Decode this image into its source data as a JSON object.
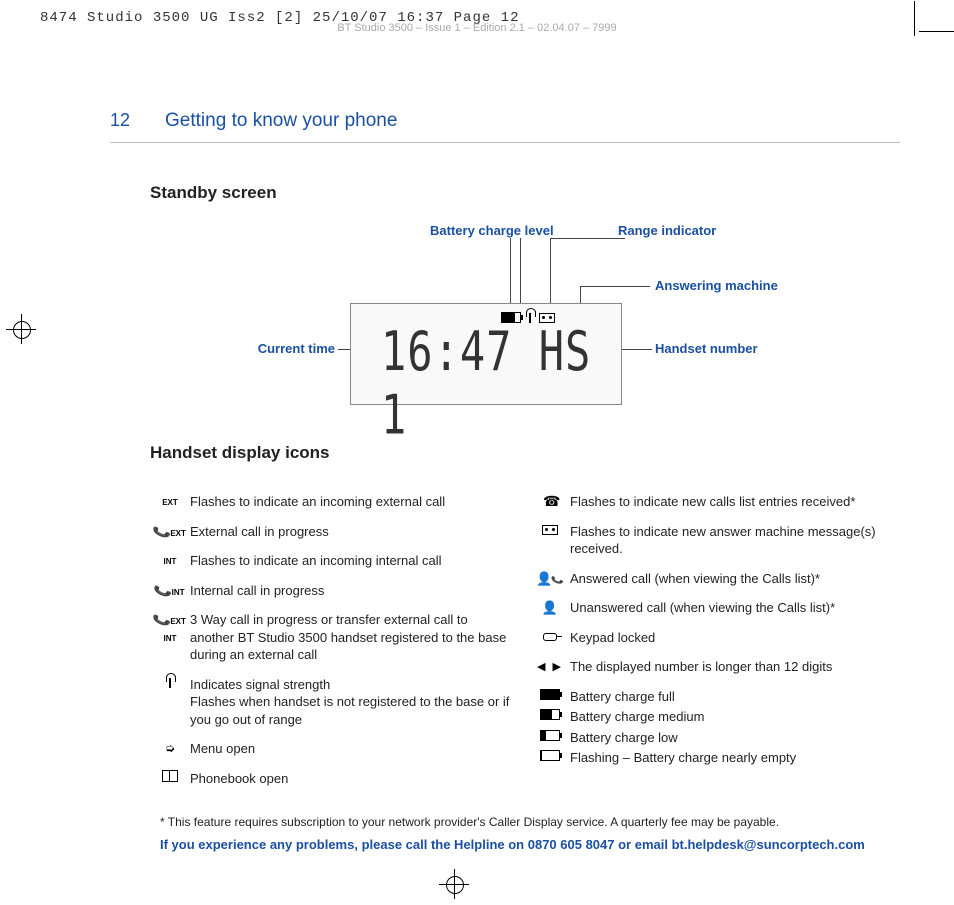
{
  "print_header": {
    "slug": "8474 Studio 3500 UG Iss2 [2]  25/10/07  16:37  Page 12",
    "running": "BT Studio 3500 – Issue 1 – Edition 2.1 – 02.04.07 – 7999"
  },
  "page": {
    "number": "12",
    "section": "Getting to know your phone"
  },
  "standby": {
    "heading": "Standby screen",
    "callouts": {
      "battery": "Battery charge level",
      "range": "Range indicator",
      "answering": "Answering machine",
      "handset": "Handset number",
      "time": "Current time"
    },
    "lcd": {
      "digits": "16:47 HS 1"
    }
  },
  "icons": {
    "heading": "Handset display icons",
    "left": [
      {
        "glyph": "EXT",
        "text": "Flashes to indicate an incoming external call"
      },
      {
        "glyph": "recv-ext",
        "text": "External call in progress"
      },
      {
        "glyph": "INT",
        "text": "Flashes to indicate an incoming internal call"
      },
      {
        "glyph": "recv-int",
        "text": "Internal call in progress"
      },
      {
        "glyph": "recv-ext-int",
        "text": "3 Way call in progress or transfer external call to another BT Studio 3500 handset registered to the base during an external call"
      },
      {
        "glyph": "antenna",
        "text": "Indicates signal strength\nFlashes when handset is not registered to the base or if you go out of range"
      },
      {
        "glyph": "menu-arrow",
        "text": "Menu open"
      },
      {
        "glyph": "book",
        "text": "Phonebook open"
      }
    ],
    "right": [
      {
        "glyph": "phone",
        "text": "Flashes to indicate new calls list entries received*"
      },
      {
        "glyph": "tape",
        "text": "Flashes to indicate new answer machine message(s) received."
      },
      {
        "glyph": "person-recv",
        "text": "Answered call (when viewing the Calls list)*"
      },
      {
        "glyph": "person",
        "text": "Unanswered call (when viewing the Calls list)*"
      },
      {
        "glyph": "key",
        "text": "Keypad locked"
      },
      {
        "glyph": "arrows",
        "text": "The displayed number is longer than 12 digits"
      },
      {
        "glyph": "bat-full",
        "text": "Battery charge full"
      },
      {
        "glyph": "bat-med",
        "text": "Battery charge medium"
      },
      {
        "glyph": "bat-low",
        "text": "Battery charge low"
      },
      {
        "glyph": "bat-empty",
        "text": "Flashing – Battery charge nearly empty"
      }
    ]
  },
  "footnote": "*  This feature requires subscription to your network provider's Caller Display service. A quarterly fee may be payable.",
  "helpline": "If you experience any problems, please call the Helpline on 0870 605 8047 or email bt.helpdesk@suncorptech.com"
}
